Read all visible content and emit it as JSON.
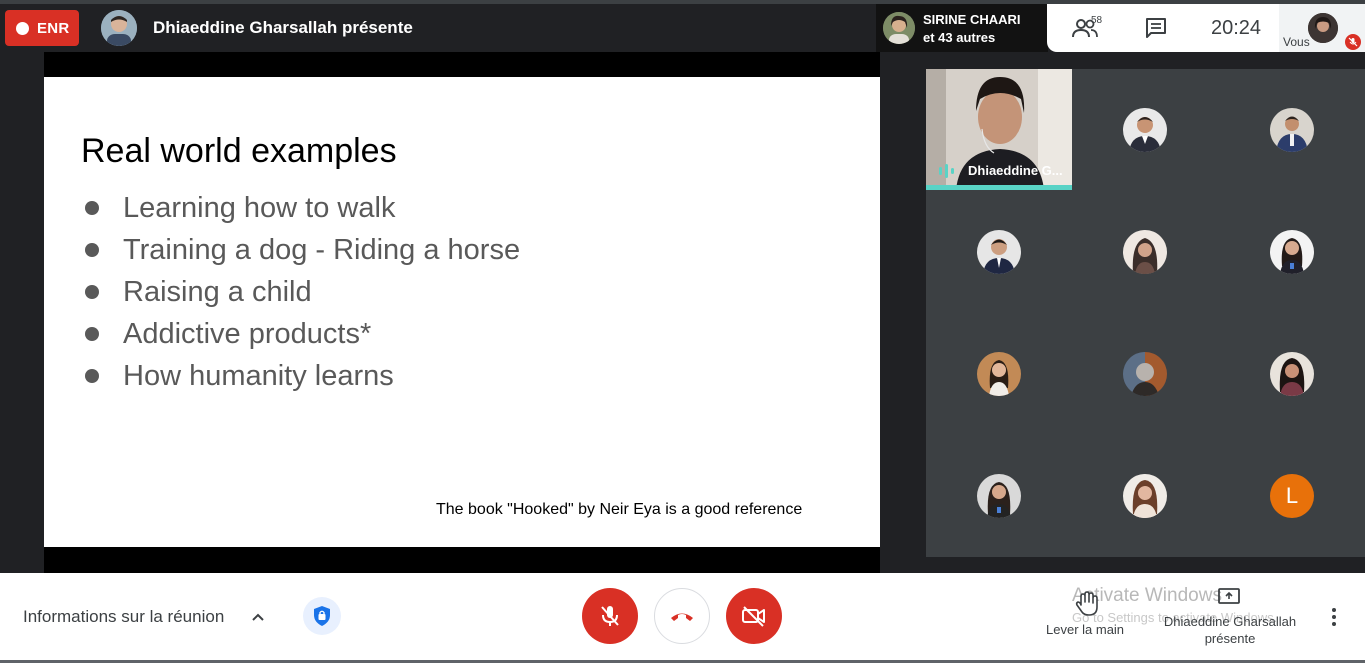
{
  "header": {
    "record_label": "ENR",
    "presenting_text": "Dhiaeddine Gharsallah présente",
    "active_speaker": {
      "name": "SIRINE CHAARI",
      "others": "et 43 autres"
    },
    "participants_count": "58",
    "clock": "20:24",
    "self_label": "Vous"
  },
  "slide": {
    "title": "Real world examples",
    "bullets": [
      "Learning how to walk",
      "Training a dog - Riding a horse",
      "Raising a child",
      "Addictive products*",
      "How humanity learns"
    ],
    "footnote": "The book \"Hooked\" by Neir Eya is a good reference"
  },
  "grid": {
    "video_tile_name": "Dhiaeddine G...",
    "letter_avatar": "L"
  },
  "bottom": {
    "meeting_info_label": "Informations sur la réunion",
    "raise_hand_label": "Lever la main",
    "presenting_label": "Dhiaeddine Gharsallah présente",
    "watermark_title": "Activate Windows",
    "watermark_sub": "Go to Settings to activate Windows."
  },
  "colors": {
    "record_red": "#d93025",
    "speaking_teal": "#59d3c6",
    "letter_avatar_orange": "#e8710a",
    "tile_background": "#3c4043"
  }
}
